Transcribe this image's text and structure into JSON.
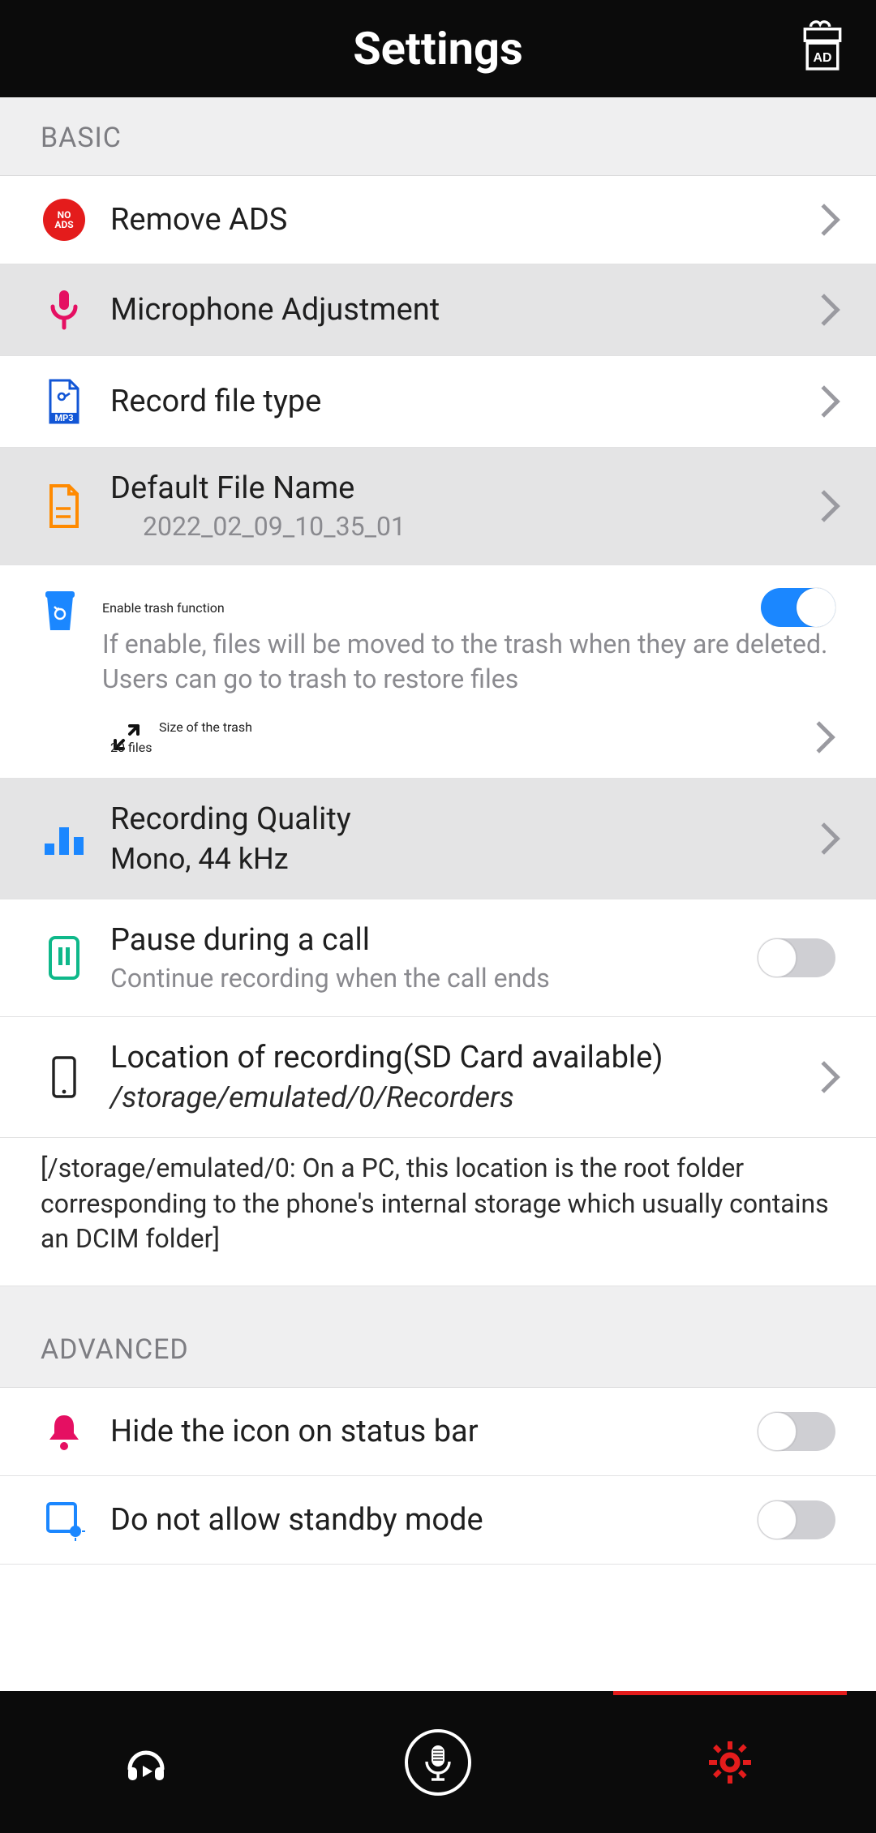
{
  "header": {
    "title": "Settings"
  },
  "sections": {
    "basic": {
      "heading": "BASIC",
      "remove_ads": {
        "label": "Remove ADS"
      },
      "mic_adjust": {
        "label": "Microphone Adjustment"
      },
      "record_type": {
        "label": "Record file type"
      },
      "default_name": {
        "label": "Default File Name",
        "value": "2022_02_09_10_35_01"
      },
      "trash": {
        "label": "Enable trash function",
        "desc": "If enable, files will be moved to the trash when they are deleted. Users can go to trash to restore files",
        "enabled": true,
        "size_label": "Size of the trash",
        "size_value": "20 files"
      },
      "quality": {
        "label": "Recording Quality",
        "value": "Mono,  44 kHz"
      },
      "pause_call": {
        "label": "Pause during a call",
        "desc": "Continue recording when the call ends",
        "enabled": false
      },
      "location": {
        "label": "Location of recording(SD Card available)",
        "value": "/storage/emulated/0/Recorders"
      },
      "location_note": "[/storage/emulated/0: On a PC, this location is the root folder corresponding to the phone's internal storage which usually contains an DCIM folder]"
    },
    "advanced": {
      "heading": "ADVANCED",
      "hide_icon": {
        "label": "Hide the icon on status bar",
        "enabled": false
      },
      "no_standby": {
        "label": "Do not allow standby mode",
        "enabled": false
      }
    }
  },
  "nav": {
    "items": [
      "playback",
      "record",
      "settings"
    ],
    "active": "settings"
  },
  "colors": {
    "accent_red": "#e41c1c",
    "accent_pink": "#e50f62",
    "accent_blue": "#1b87ff",
    "accent_teal": "#0fb88a",
    "accent_orange": "#ff8a00"
  }
}
